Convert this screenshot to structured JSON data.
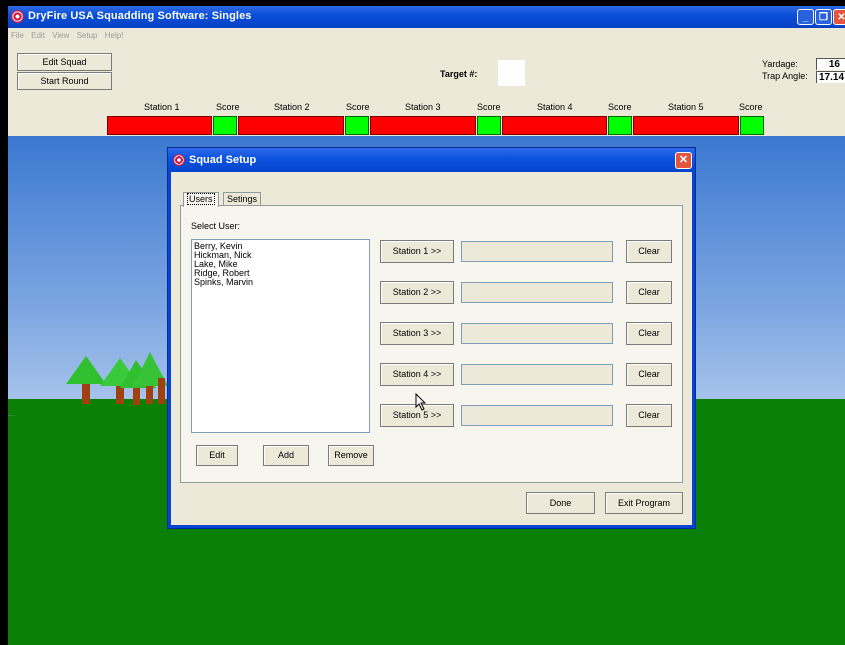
{
  "app": {
    "title": "DryFire USA Squadding Software: Singles",
    "menu": [
      "File",
      "Edit",
      "View",
      "Setup",
      "Help!"
    ]
  },
  "toolbar": {
    "edit_squad": "Edit Squad",
    "start_round": "Start Round",
    "target_label": "Target #:",
    "target_value": "",
    "yardage_label": "Yardage:",
    "yardage_value": "16",
    "trap_angle_label": "Trap Angle:",
    "trap_angle_value": "17.14"
  },
  "stations": {
    "labels": [
      "Station 1",
      "Station 2",
      "Station 3",
      "Station 4",
      "Station 5"
    ],
    "score_label": "Score"
  },
  "dialog": {
    "title": "Squad Setup",
    "tabs": [
      "Users",
      "Setings"
    ],
    "select_user_label": "Select User:",
    "users": [
      "Berry, Kevin",
      "Hickman, Nick",
      "Lake, Mike",
      "Ridge, Robert",
      "Spinks, Marvin"
    ],
    "station_buttons": [
      "Station 1 >>",
      "Station 2 >>",
      "Station 3 >>",
      "Station 4 >>",
      "Station 5 >>"
    ],
    "station_fields": [
      "",
      "",
      "",
      "",
      ""
    ],
    "clear_label": "Clear",
    "edit_label": "Edit",
    "add_label": "Add",
    "remove_label": "Remove",
    "done_label": "Done",
    "exit_label": "Exit Program"
  },
  "colors": {
    "titlebar": "#0a52e0",
    "station_bar": "#ff0000",
    "score_box": "#00ff00",
    "ground": "#0b8009"
  }
}
